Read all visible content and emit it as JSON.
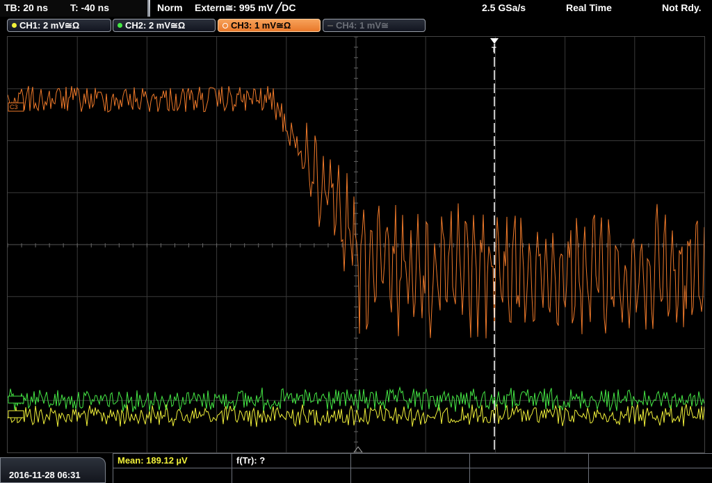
{
  "status": {
    "timebase": "TB: 20 ns",
    "trigger_time": "T: -40 ns",
    "trigger_mode": "Norm",
    "trigger_source": "Extern≅: 995 mV ╱DC",
    "sample_rate": "2.5 GSa/s",
    "acq_mode": "Real Time",
    "run_state": "Not Rdy."
  },
  "channels": [
    {
      "label": "CH1: 2 mV≅Ω",
      "color": "#f2f23a",
      "state": "on"
    },
    {
      "label": "CH2: 2 mV≅Ω",
      "color": "#45e845",
      "state": "on"
    },
    {
      "label": "CH3: 1 mV≅Ω",
      "color": "#f38b3d",
      "state": "selected"
    },
    {
      "label": "CH4: 1 mV≅",
      "color": "#6b6f77",
      "state": "off"
    }
  ],
  "markers": {
    "ch3": "C3",
    "trigger": "T"
  },
  "colors": {
    "ch1": "#f2f23a",
    "ch2": "#45e845",
    "ch3": "#f07a2a",
    "grid": "#3a3a3a",
    "trigger_line": "#ffffff"
  },
  "measurements": {
    "mean": "Mean: 189.12 µV",
    "frequency": "f(Tr): ?"
  },
  "datetime": "2016-11-28 06:31"
}
